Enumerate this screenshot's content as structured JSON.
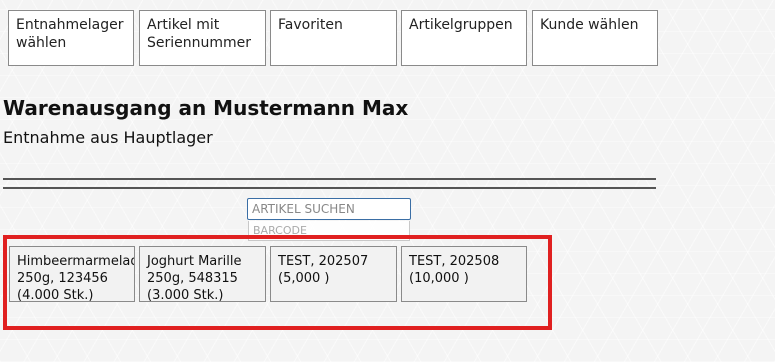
{
  "toolbar": {
    "buttons": [
      {
        "label": "Entnahmelager wählen"
      },
      {
        "label": "Artikel mit Seriennummer"
      },
      {
        "label": "Favoriten"
      },
      {
        "label": "Artikelgruppen"
      },
      {
        "label": "Kunde wählen"
      }
    ]
  },
  "header": {
    "title": "Warenausgang an Mustermann Max",
    "subtitle": "Entnahme aus Hauptlager"
  },
  "search": {
    "placeholder": "ARTIKEL SUCHEN",
    "barcode_placeholder": "BARCODE"
  },
  "items": [
    {
      "name": "Himbeermarmelade",
      "detail": "250g, 123456",
      "qty": "(4.000 Stk.)"
    },
    {
      "name": "Joghurt Marille",
      "detail": "250g, 548315",
      "qty": "(3.000 Stk.)"
    },
    {
      "name": "TEST, 202507",
      "detail": "(5,000 )",
      "qty": ""
    },
    {
      "name": "TEST, 202508",
      "detail": "(10,000 )",
      "qty": ""
    }
  ],
  "colors": {
    "highlight": "#e02020",
    "input_border": "#3a6ea5"
  }
}
